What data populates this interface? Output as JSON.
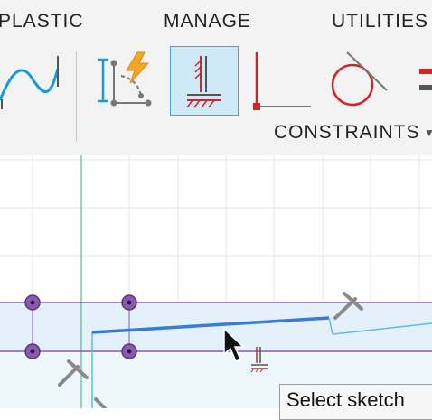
{
  "toolbar": {
    "tabs": [
      {
        "label": "PLASTIC"
      },
      {
        "label": "MANAGE"
      },
      {
        "label": "UTILITIES"
      }
    ],
    "group_label": "CONSTRAINTS",
    "tools": [
      {
        "name": "spline-tool",
        "icon": "spline-icon"
      },
      {
        "name": "parameters-tool",
        "icon": "dimension-lightning-icon"
      },
      {
        "name": "horizontal-vertical-constraint",
        "icon": "horizontal-vertical-constraint-icon",
        "active": true
      },
      {
        "name": "perpendicular-constraint",
        "icon": "perpendicular-icon"
      },
      {
        "name": "tangent-constraint",
        "icon": "tangent-icon"
      },
      {
        "name": "equal-constraint",
        "icon": "equal-icon"
      }
    ]
  },
  "colors": {
    "accent": "#1a9ad6",
    "active_bg": "#cfe9f7",
    "constraint_red": "#d2232a",
    "sketch_line": "#3a7bd5",
    "construction_purple": "#8a59b0",
    "axis_green": "#4fc28a"
  },
  "canvas": {
    "tooltip": "Select sketch"
  }
}
